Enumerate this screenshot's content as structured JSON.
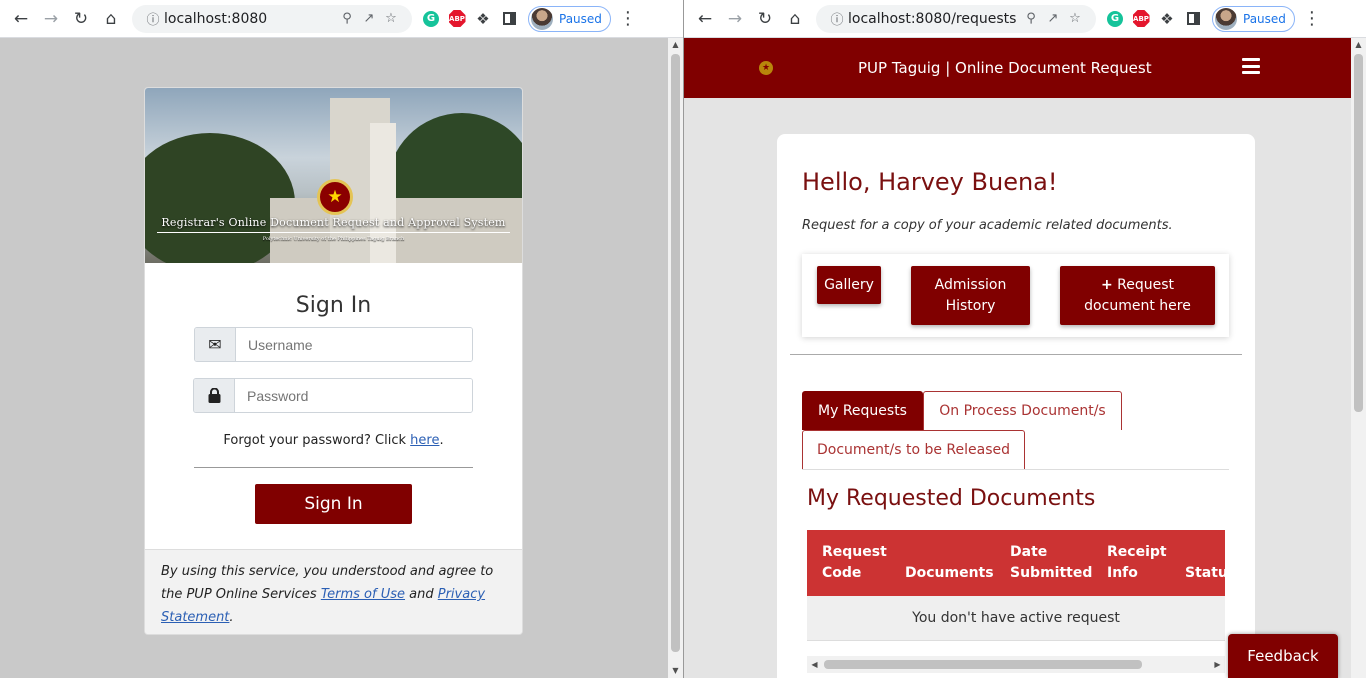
{
  "left_window": {
    "address": "localhost:8080",
    "profile_status": "Paused",
    "extensions": {
      "grammarly": "G",
      "adblock": "ABP"
    },
    "banner": {
      "title": "Registrar's Online Document Request and Approval System",
      "subtitle": "Polytechnic University of the Philippines Taguig Branch"
    },
    "login": {
      "title": "Sign In",
      "username_placeholder": "Username",
      "password_placeholder": "Password",
      "forgot_text": "Forgot your password? Click ",
      "forgot_link": "here",
      "forgot_suffix": ".",
      "submit_label": "Sign In",
      "footer_prefix": "By using this service, you understood and agree to the PUP Online Services ",
      "terms_link": "Terms of Use",
      "footer_and": " and ",
      "privacy_link": "Privacy Statement",
      "footer_suffix": "."
    }
  },
  "right_window": {
    "address": "localhost:8080/requests",
    "profile_status": "Paused",
    "extensions": {
      "grammarly": "G",
      "adblock": "ABP"
    },
    "navbar": {
      "title": "PUP Taguig | Online Document Request"
    },
    "greeting": "Hello, Harvey Buena!",
    "subtext": "Request for a copy of your academic related documents.",
    "actions": {
      "gallery": "Gallery",
      "admission_line1": "Admission",
      "admission_line2": "History",
      "request_line1": "Request",
      "request_line2": "document here"
    },
    "tabs": [
      "My Requests",
      "On Process Document/s",
      "Document/s to be Released"
    ],
    "active_tab": "My Requests",
    "section_title": "My Requested Documents",
    "table": {
      "header_color": "#cc3333",
      "columns": [
        {
          "line1": "Request",
          "line2": "Code"
        },
        {
          "line1": "",
          "line2": "Documents"
        },
        {
          "line1": "Date",
          "line2": "Submitted"
        },
        {
          "line1": "Receipt",
          "line2": "Info"
        },
        {
          "line1": "",
          "line2": "Status"
        }
      ],
      "empty_message": "You don't have active request"
    },
    "feedback_label": "Feedback"
  },
  "colors": {
    "brand_maroon": "#800000",
    "table_header_red": "#cc3333"
  }
}
